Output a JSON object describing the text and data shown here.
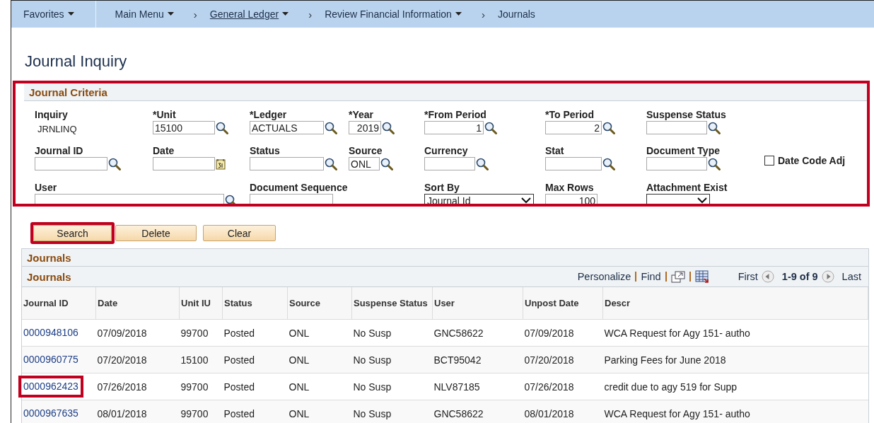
{
  "nav": {
    "items": [
      {
        "kind": "menu",
        "label": "Favorites",
        "underlined": false
      },
      {
        "kind": "menu",
        "label": "Main Menu",
        "underlined": false
      },
      {
        "kind": "separator",
        "label": "›"
      },
      {
        "kind": "menu",
        "label": "General Ledger",
        "underlined": true
      },
      {
        "kind": "separator",
        "label": "›"
      },
      {
        "kind": "menu",
        "label": "Review Financial Information",
        "underlined": false
      },
      {
        "kind": "separator",
        "label": "›"
      },
      {
        "kind": "current",
        "label": "Journals"
      }
    ]
  },
  "page_title": "Journal Inquiry",
  "criteria": {
    "title": "Journal Criteria",
    "highlighted": true,
    "rows": [
      [
        {
          "kind": "display",
          "label": "Inquiry",
          "value": "JRNLINQ"
        },
        {
          "kind": "lookup",
          "label": "*Unit",
          "value": "15100"
        },
        {
          "kind": "lookup",
          "label": "*Ledger",
          "value": "ACTUALS"
        },
        {
          "kind": "number-lookup",
          "label": "*Year",
          "value": "2019"
        },
        {
          "kind": "number-lookup",
          "label": "*From Period",
          "value": "1"
        },
        {
          "kind": "number-lookup",
          "label": "*To Period",
          "value": "2"
        },
        {
          "kind": "lookup",
          "label": "Suspense Status"
        }
      ],
      [
        {
          "kind": "lookup",
          "label": "Journal ID"
        },
        {
          "kind": "date",
          "label": "Date"
        },
        {
          "kind": "lookup",
          "label": "Status"
        },
        {
          "kind": "lookup",
          "label": "Source",
          "value": "ONL"
        },
        {
          "kind": "lookup",
          "label": "Currency"
        },
        {
          "kind": "lookup",
          "label": "Stat"
        },
        {
          "kind": "lookup",
          "label": "Document Type"
        },
        {
          "kind": "checkbox",
          "label": "Date Code Adj",
          "checked": false
        }
      ],
      [
        {
          "kind": "lookup",
          "label": "User"
        },
        "",
        {
          "kind": "text",
          "label": "Document Sequence"
        },
        "",
        {
          "kind": "select",
          "label": "Sort By",
          "value": "Journal Id"
        },
        {
          "kind": "number",
          "label": "Max Rows",
          "value": "100"
        },
        {
          "kind": "select",
          "label": "Attachment Exist"
        }
      ]
    ]
  },
  "buttons": [
    {
      "label": "Search",
      "highlighted": true
    },
    {
      "label": "Delete",
      "highlighted": false
    },
    {
      "label": "Clear",
      "highlighted": false
    }
  ],
  "journals": {
    "title": "Journals",
    "grid_title": "Journals",
    "toolbar": {
      "personalize": "Personalize",
      "find": "Find",
      "first": "First",
      "range": "1-9 of 9",
      "last": "Last"
    },
    "columns": [
      "Journal ID",
      "Date",
      "Unit IU",
      "Status",
      "Source",
      "Suspense Status",
      "User",
      "Unpost Date",
      "Descr"
    ],
    "rows": [
      {
        "highlighted": false,
        "cells": [
          "0000948106",
          "07/09/2018",
          "99700",
          "Posted",
          "ONL",
          "No Susp",
          "GNC58622",
          "07/09/2018",
          "WCA Request for Agy 151- autho"
        ]
      },
      {
        "highlighted": false,
        "cells": [
          "0000960775",
          "07/20/2018",
          "15100",
          "Posted",
          "ONL",
          "No Susp",
          "BCT95042",
          "07/20/2018",
          "Parking Fees for June 2018"
        ]
      },
      {
        "highlighted": true,
        "cells": [
          "0000962423",
          "07/26/2018",
          "99700",
          "Posted",
          "ONL",
          "No Susp",
          "NLV87185",
          "07/26/2018",
          "credit due to agy 519 for Supp"
        ]
      },
      {
        "highlighted": false,
        "cells": [
          "0000967635",
          "08/01/2018",
          "99700",
          "Posted",
          "ONL",
          "No Susp",
          "GNC58622",
          "08/01/2018",
          "WCA Request for Agy 151- autho"
        ]
      }
    ]
  }
}
